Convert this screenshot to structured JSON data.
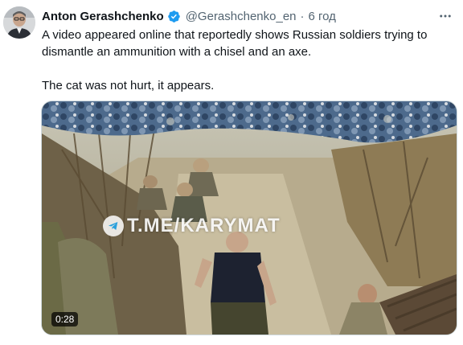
{
  "tweet": {
    "author_name": "Anton Gerashchenko",
    "handle": "@Gerashchenko_en",
    "separator": "·",
    "time": "6 год",
    "more_icon": "more-horizontal-icon",
    "verified_icon": "verified-badge-icon",
    "text": "A video appeared online that reportedly shows Russian soldiers trying to dismantle an ammunition with a chisel and an axe.\n\nThe cat was not hurt, it appears."
  },
  "media": {
    "watermark": "T.ME/KARYMAT",
    "duration": "0:28"
  },
  "colors": {
    "verified": "#1d9bf0",
    "secondary_text": "#536471",
    "primary_text": "#0f1419"
  }
}
